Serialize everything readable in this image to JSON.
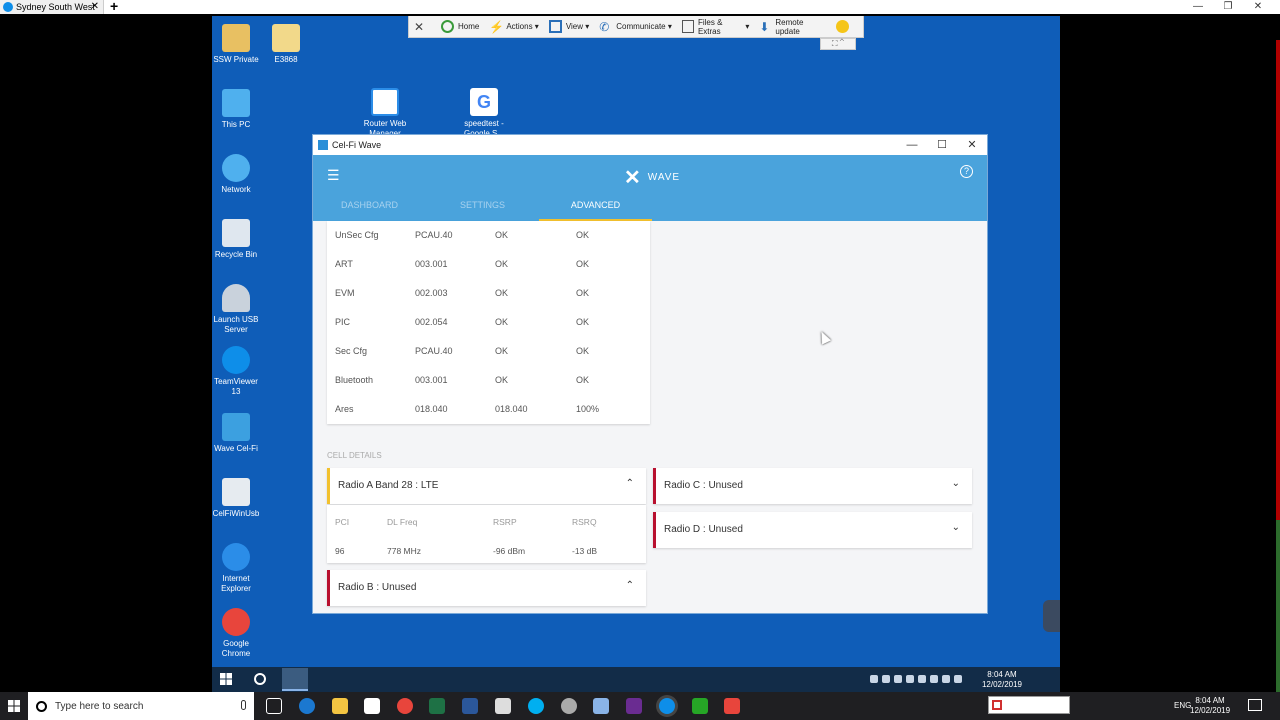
{
  "host": {
    "tab_title": "Sydney South West",
    "search_placeholder": "Type here to search",
    "lang": "ENG",
    "time": "8:04 AM",
    "date": "12/02/2019"
  },
  "desktop_icons": [
    {
      "label": "SSW Private",
      "color": "#e8c062"
    },
    {
      "label": "E3868",
      "color": "#f2d98a"
    },
    {
      "label": "This PC",
      "color": "#4fb0ee"
    },
    {
      "label": "Network",
      "color": "#4fb0ee"
    },
    {
      "label": "Recycle Bin",
      "color": "#dfe7ef"
    },
    {
      "label": "Launch USB Server",
      "color": "#c9d2dc"
    },
    {
      "label": "TeamViewer 13",
      "color": "#0e8ee9"
    },
    {
      "label": "Wave Cel-Fi",
      "color": "#3ca0e0"
    },
    {
      "label": "CelFiWinUsb",
      "color": "#e6ebf0"
    },
    {
      "label": "Internet Explorer",
      "color": "#2b8de8"
    },
    {
      "label": "Google Chrome",
      "color": "#e8453c"
    },
    {
      "label": "Router Web Manager",
      "color": "#2b8de8"
    },
    {
      "label": "speedtest - Google S...",
      "color": "#ffffff"
    }
  ],
  "tv_toolbar": {
    "items": [
      "Home",
      "Actions",
      "View",
      "Communicate",
      "Files & Extras",
      "Remote update"
    ]
  },
  "window": {
    "title": "Cel-Fi Wave",
    "logo_text": "WAVE",
    "tabs": [
      "DASHBOARD",
      "SETTINGS",
      "ADVANCED"
    ],
    "active_tab": "ADVANCED"
  },
  "versions": [
    {
      "name": "UnSec Cfg",
      "v1": "PCAU.40",
      "v2": "OK",
      "v3": "OK"
    },
    {
      "name": "ART",
      "v1": "003.001",
      "v2": "OK",
      "v3": "OK"
    },
    {
      "name": "EVM",
      "v1": "002.003",
      "v2": "OK",
      "v3": "OK"
    },
    {
      "name": "PIC",
      "v1": "002.054",
      "v2": "OK",
      "v3": "OK"
    },
    {
      "name": "Sec Cfg",
      "v1": "PCAU.40",
      "v2": "OK",
      "v3": "OK"
    },
    {
      "name": "Bluetooth",
      "v1": "003.001",
      "v2": "OK",
      "v3": "OK"
    },
    {
      "name": "Ares",
      "v1": "018.040",
      "v2": "018.040",
      "v3": "100%"
    }
  ],
  "cell_details": {
    "label": "CELL DETAILS",
    "radio_a": {
      "title": "Radio A Band 28 : LTE",
      "headers": [
        "PCI",
        "DL Freq",
        "RSRP",
        "RSRQ"
      ],
      "values": [
        "96",
        "778 MHz",
        "-96 dBm",
        "-13 dB"
      ]
    },
    "radio_b": "Radio B : Unused",
    "radio_c": "Radio C : Unused",
    "radio_d": "Radio D : Unused"
  },
  "remote_clock": {
    "time": "8:04 AM",
    "date": "12/02/2019"
  }
}
